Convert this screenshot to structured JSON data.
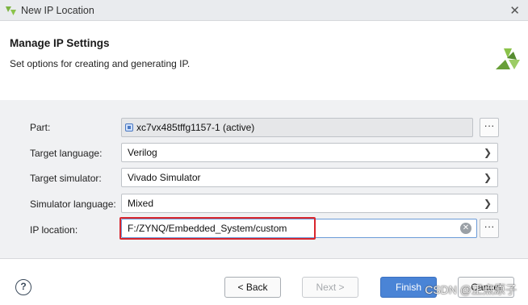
{
  "window": {
    "title": "New IP Location",
    "close_icon": "close-icon"
  },
  "header": {
    "title": "Manage IP Settings",
    "subtitle": "Set options for creating and generating IP."
  },
  "form": {
    "part": {
      "label": "Part:",
      "value": "xc7vx485tffg1157-1 (active)",
      "browse": "···"
    },
    "target_language": {
      "label": "Target language:",
      "value": "Verilog"
    },
    "target_simulator": {
      "label": "Target simulator:",
      "value": "Vivado Simulator"
    },
    "simulator_language": {
      "label": "Simulator language:",
      "value": "Mixed"
    },
    "ip_location": {
      "label": "IP location:",
      "value": "F:/ZYNQ/Embedded_System/custom",
      "browse": "···"
    }
  },
  "footer": {
    "help": "?",
    "back": "< Back",
    "next": "Next >",
    "finish": "Finish",
    "cancel": "Cancel",
    "watermark": "CSDN @正点原子"
  },
  "colors": {
    "accent": "#4a84d6",
    "highlight": "#d9262d",
    "logo": "#7cb342"
  }
}
